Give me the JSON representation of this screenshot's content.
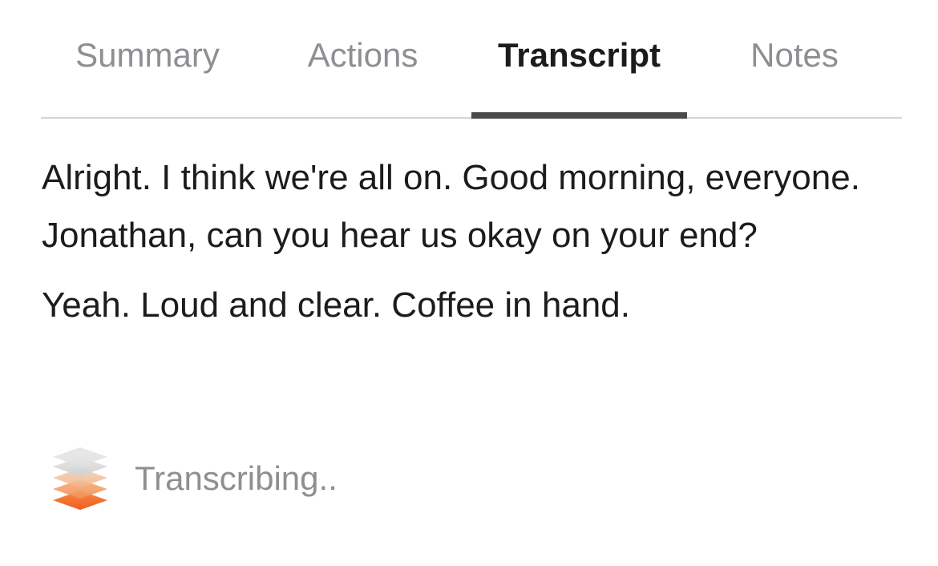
{
  "tabs": {
    "summary": "Summary",
    "actions": "Actions",
    "transcript": "Transcript",
    "notes": "Notes",
    "active": "transcript"
  },
  "transcript": {
    "utterances": [
      "Alright. I think we're all on. Good morning, everyone. Jonathan, can you hear us okay on your end?",
      "Yeah. Loud and clear. Coffee in hand."
    ]
  },
  "status": {
    "icon": "layers-icon",
    "text": "Transcribing..",
    "accent_colors": [
      "#f26b2a",
      "#f7a35c",
      "#c9c9c9"
    ]
  }
}
